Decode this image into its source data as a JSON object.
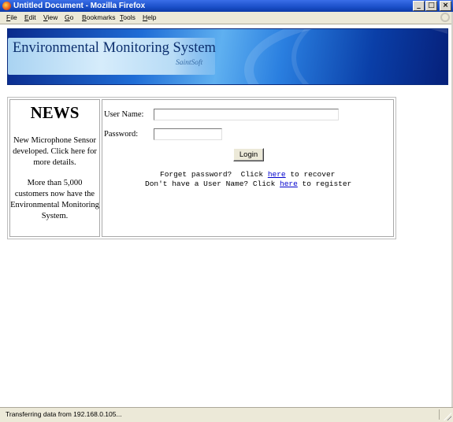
{
  "window": {
    "title": "Untitled Document - Mozilla Firefox",
    "controls": [
      "minimize-icon",
      "maximize-icon",
      "close-icon"
    ]
  },
  "menubar": {
    "items": [
      {
        "label": "File",
        "ul": "F",
        "rest": "ile"
      },
      {
        "label": "Edit",
        "ul": "E",
        "rest": "dit"
      },
      {
        "label": "View",
        "ul": "V",
        "rest": "iew"
      },
      {
        "label": "Go",
        "ul": "G",
        "rest": "o"
      },
      {
        "label": "Bookmarks",
        "ul": "B",
        "rest": "ookmarks"
      },
      {
        "label": "Tools",
        "ul": "T",
        "rest": "ools"
      },
      {
        "label": "Help",
        "ul": "H",
        "rest": "elp"
      }
    ]
  },
  "banner": {
    "title": "Environmental Monitoring System",
    "subtitle": "SaintSoft"
  },
  "news": {
    "heading": "NEWS",
    "items": [
      "New Microphone Sensor developed. Click here for more details.",
      "More than 5,000 customers now have the Environmental Monitoring System."
    ]
  },
  "login": {
    "username_label": "User Name:",
    "username_value": "",
    "password_label": "Password:",
    "password_value": "",
    "button_label": "Login",
    "forgot_prefix": "Forget password?  Click ",
    "forgot_link": "here",
    "forgot_suffix": " to recover",
    "register_prefix": "Don't have a User Name? Click ",
    "register_link": "here",
    "register_suffix": " to register"
  },
  "status": {
    "text": "Transferring data from 192.168.0.105..."
  },
  "colors": {
    "titlebar": "#1a4fc8",
    "link": "#0000cc",
    "chrome": "#ece9d8"
  }
}
